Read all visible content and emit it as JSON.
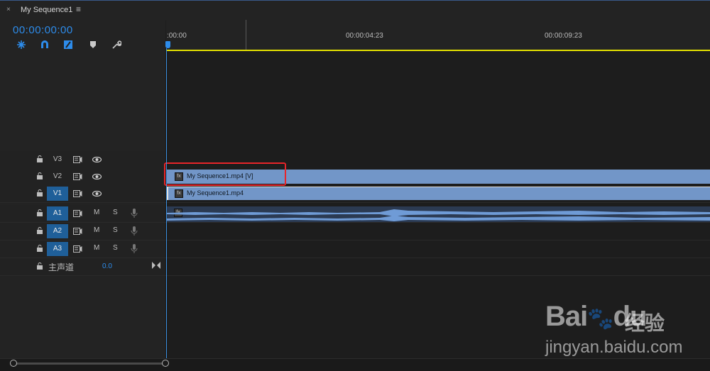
{
  "window": {
    "title": "My Sequence1",
    "close_icon": "×",
    "menu_icon": "≡"
  },
  "timecode": "00:00:00:00",
  "tools": [
    "ripple-edit-icon",
    "snap-magnet-icon",
    "linked-selection-icon",
    "marker-icon",
    "wrench-icon"
  ],
  "ruler": {
    "labels": [
      ":00:00",
      "00:00:04:23",
      "00:00:09:23"
    ]
  },
  "tracks": [
    {
      "name": "V3",
      "kind": "video",
      "targeted": false
    },
    {
      "name": "V2",
      "kind": "video",
      "targeted": false
    },
    {
      "name": "V1",
      "kind": "video",
      "targeted": true
    },
    {
      "name": "A1",
      "kind": "audio",
      "targeted": true,
      "mute": "M",
      "solo": "S"
    },
    {
      "name": "A2",
      "kind": "audio",
      "targeted": true,
      "mute": "M",
      "solo": "S"
    },
    {
      "name": "A3",
      "kind": "audio",
      "targeted": true,
      "mute": "M",
      "solo": "S"
    }
  ],
  "master": {
    "name": "主声道",
    "value": "0.0"
  },
  "clips": {
    "v2": {
      "label": "My Sequence1.mp4 [V]",
      "fx": "fx"
    },
    "v1": {
      "label": "My Sequence1.mp4",
      "fx": "fx"
    },
    "a1": {
      "fx": "fx"
    }
  },
  "watermark": {
    "logo": "Bai",
    "logo2": "du",
    "cn": "经验",
    "url": "jingyan.baidu.com"
  },
  "colors": {
    "accent": "#2d8ceb",
    "clip": "#7296c8",
    "work_area": "#e3e000",
    "highlight": "#e8252a"
  }
}
